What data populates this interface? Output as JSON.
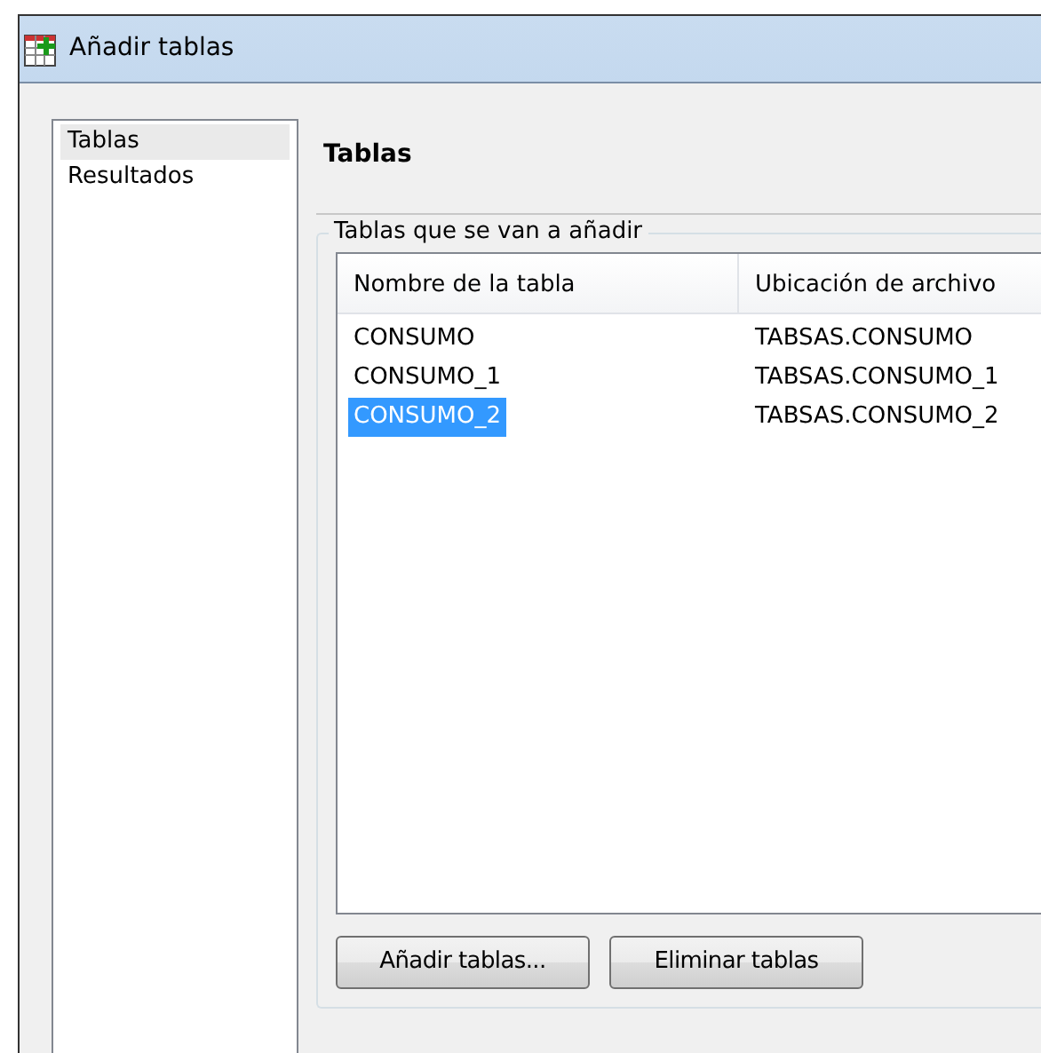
{
  "window": {
    "title": "Añadir tablas"
  },
  "sidebar": {
    "items": [
      {
        "label": "Tablas",
        "selected": true
      },
      {
        "label": "Resultados",
        "selected": false
      }
    ]
  },
  "page_title": "Tablas",
  "group": {
    "legend": "Tablas que se van a añadir"
  },
  "table": {
    "columns": [
      "Nombre de la tabla",
      "Ubicación de archivo"
    ],
    "rows": [
      {
        "cells": [
          "CONSUMO",
          "TABSAS.CONSUMO"
        ],
        "selected": false
      },
      {
        "cells": [
          "CONSUMO_1",
          "TABSAS.CONSUMO_1"
        ],
        "selected": false
      },
      {
        "cells": [
          "CONSUMO_2",
          "TABSAS.CONSUMO_2"
        ],
        "selected": true
      }
    ]
  },
  "buttons": [
    "Añadir tablas...",
    "Eliminar tablas"
  ]
}
